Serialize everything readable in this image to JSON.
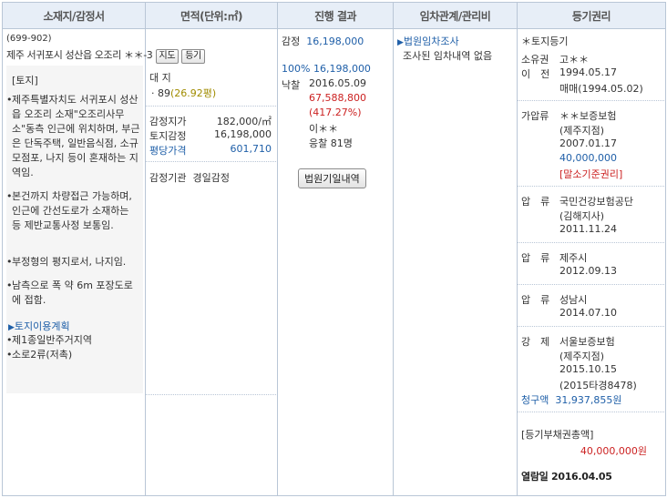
{
  "headers": [
    "소재지/감정서",
    "면적(단위:㎡)",
    "진행 결과",
    "임차관계/관리비",
    "등기권리"
  ],
  "location": {
    "postal": "(699-902)",
    "address": "제주 서귀포시 성산읍 오조리 ＊＊-3",
    "map_btn": "지도",
    "reg_btn": "등기",
    "land_title": "[토지]",
    "bullets": [
      "제주특별자치도 서귀포시 성산읍 오조리 소재\"오조리사무소\"동측 인근에 위치하며, 부근은 단독주택, 일반음식점, 소규모점포, 나지 등이 혼재하는 지역임.",
      "본건까지 차량접근 가능하며, 인근에 간선도로가 소재하는 등 제반교통사정 보통임.",
      "부정형의 평지로서, 나지임.",
      "남측으로 폭 약 6m 포장도로에 접함."
    ],
    "plan_title": "토지이용계획",
    "plan_items": [
      "제1종일반주거지역",
      "소로2류(저촉)"
    ]
  },
  "area": {
    "land_label": "대 지",
    "land_value": "· 89",
    "land_pyeong": "(26.92평)",
    "appraisal_label": "감정지가",
    "appraisal_value": "182,000/㎡",
    "land_appraisal_label": "토지감정",
    "land_appraisal_value": "16,198,000",
    "avg_label": "평당가격",
    "avg_value": "601,710",
    "agency_label": "감정기관",
    "agency_value": "경일감정"
  },
  "progress": {
    "appraisal_label": "감정",
    "appraisal_value": "16,198,000",
    "min_pct": "100%",
    "min_value": "16,198,000",
    "sold_label": "낙찰",
    "sold_date": "2016.05.09",
    "sold_price": "67,588,800",
    "sold_pct": "(417.27%)",
    "buyer": "이＊＊",
    "bidders": "응찰 81명",
    "court_btn": "법원기일내역"
  },
  "lease": {
    "title": "법원임차조사",
    "text": "조사된 임차내역 없음"
  },
  "rights": {
    "head": "＊토지등기",
    "owner_label": "소유권",
    "owner_name": "고＊＊",
    "transfer_label": "이　전",
    "transfer_date": "1994.05.17",
    "transfer_cause": "매매(1994.05.02)",
    "items": [
      {
        "label": "가압류",
        "lines": [
          "＊＊보증보험",
          "(제주지점)",
          "2007.01.17"
        ],
        "amount": "40,000,000",
        "note": "[말소기준권리]"
      },
      {
        "label": "압　류",
        "lines": [
          "국민건강보험공단",
          "(김해지사)",
          "2011.11.24"
        ]
      },
      {
        "label": "압　류",
        "lines": [
          "제주시",
          "2012.09.13"
        ]
      },
      {
        "label": "압　류",
        "lines": [
          "성남시",
          "2014.07.10"
        ]
      },
      {
        "label": "강　제",
        "lines": [
          "서울보증보험",
          "(제주지점)",
          "2015.10.15",
          "(2015타경8478)"
        ]
      }
    ],
    "claim_label": "청구액",
    "claim_value": "31,937,855원",
    "total_label": "[등기부채권총액]",
    "total_value": "40,000,000원",
    "viewed": "열람일 2016.04.05"
  }
}
